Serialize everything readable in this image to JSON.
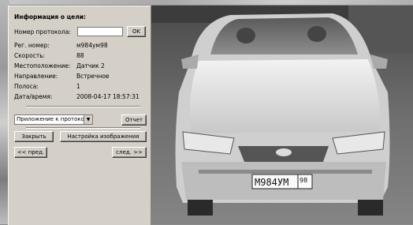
{
  "panel": {
    "title": "Информация о цели:",
    "protocol_label": "Номер протокола:",
    "protocol_value": "",
    "ok_label": "OK",
    "fields": [
      {
        "label": "Рег. номер:",
        "value": "м984ум98"
      },
      {
        "label": "Скорость:",
        "value": "88"
      },
      {
        "label": "Местоположение:",
        "value": "Датчик 2"
      },
      {
        "label": "Направление:",
        "value": "Встречное"
      },
      {
        "label": "Полоса:",
        "value": "1"
      },
      {
        "label": "Дата/время:",
        "value": "2008-04-17 18:57:31"
      }
    ],
    "select_value": "Приложение к протоколу",
    "report_label": "Отчет",
    "close_label": "Закрыть",
    "image_settings_label": "Настройка изображения",
    "prev_label": "<< пред.",
    "next_label": "след. >>"
  },
  "camera": {
    "plate_text": "М984УМ",
    "plate_region": "98"
  }
}
